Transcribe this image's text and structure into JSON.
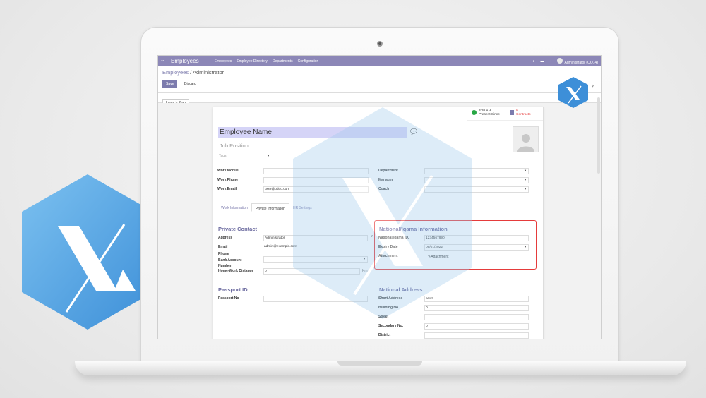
{
  "nav": {
    "apps_icon": "apps-grid-icon",
    "brand": "Employees",
    "menu": [
      "Employees",
      "Employee Directory",
      "Departments",
      "Configuration"
    ],
    "user": "Administrator (OO14)"
  },
  "breadcrumb": {
    "parent": "Employees",
    "separator": " / ",
    "current": "Administrator"
  },
  "buttons": {
    "save": "Save",
    "discard": "Discard",
    "launch_plan": "Launch Plan"
  },
  "smart_buttons": {
    "presence": {
      "time": "3:36 AM",
      "label": "Present Since"
    },
    "contracts": {
      "count": "0",
      "label": "Contracts"
    }
  },
  "header": {
    "employee_name": "Employee Name",
    "job_position_placeholder": "Job Position",
    "tags_placeholder": "Tags"
  },
  "work_fields": {
    "work_mobile_label": "Work Mobile",
    "work_phone_label": "Work Phone",
    "work_email_label": "Work Email",
    "work_email_value": "user@odoo.com",
    "department_label": "Department",
    "manager_label": "Manager",
    "coach_label": "Coach"
  },
  "tabs": [
    "Work Information",
    "Private Information",
    "HR Settings"
  ],
  "private_contact": {
    "title": "Private Contact",
    "address_label": "Address",
    "address_value": "Administrator",
    "email_label": "Email",
    "email_value": "admin@example.com",
    "phone_label": "Phone",
    "bank_label": "Bank Account Number",
    "distance_label": "Home-Work Distance",
    "distance_value": "0",
    "distance_unit": "Km"
  },
  "national_info": {
    "title": "National/Iqama Information",
    "id_label": "National/Iqama ID.",
    "id_value": "1234567890",
    "expiry_label": "Expiry Date",
    "expiry_value": "09/01/2022",
    "attachment_label": "Attachment",
    "attachment_button": "Attachment"
  },
  "passport": {
    "title": "Passport ID",
    "no_label": "Passport No"
  },
  "national_address": {
    "title": "National Address",
    "short_address_label": "Short Address",
    "short_address_value": "asws",
    "building_label": "Building No.",
    "building_value": "0",
    "street_label": "Street",
    "secondary_label": "Secondary No.",
    "secondary_value": "0",
    "district_label": "District"
  },
  "colors": {
    "brand": "#8c87b7",
    "accent": "#7c7bad",
    "highlight": "#e53b3b",
    "logo_blue": "#4a9fe0"
  }
}
